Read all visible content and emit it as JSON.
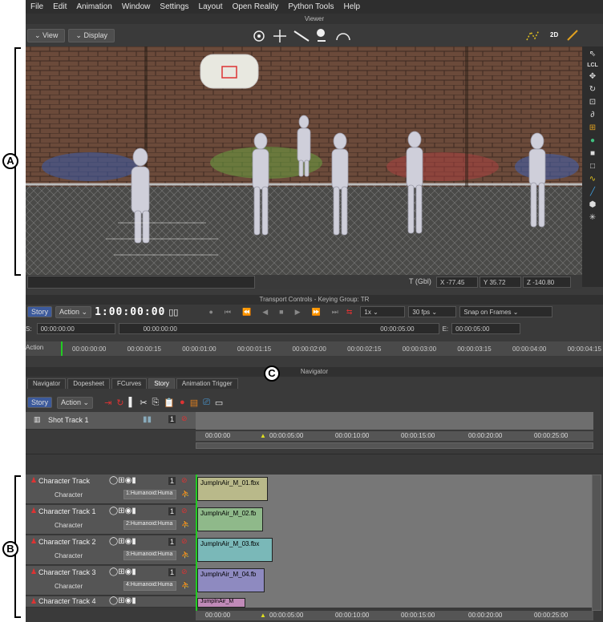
{
  "menu": [
    "File",
    "Edit",
    "Animation",
    "Window",
    "Settings",
    "Layout",
    "Open Reality",
    "Python Tools",
    "Help"
  ],
  "viewer": {
    "title": "Viewer",
    "view_btn": "View",
    "display_btn": "Display",
    "label_2d": "2D"
  },
  "viewport_side": [
    "LCL"
  ],
  "coords": {
    "label": "T (Gbl)",
    "x_label": "X",
    "x": "-77.45",
    "y_label": "Y",
    "y": "35.72",
    "z_label": "Z",
    "z": "-140.80"
  },
  "transport": {
    "title": "Transport Controls  -  Keying Group: TR",
    "story": "Story",
    "action": "Action",
    "timecode": "1:00:00:00",
    "speed": "1x",
    "fps": "30 fps",
    "snap": "Snap on Frames",
    "s_label": "S:",
    "start": "00:00:00:00",
    "start2": "00:00:00:00",
    "end": "00:00:05:00",
    "e_label": "E:",
    "end2": "00:00:05:00",
    "action_label": "Action",
    "ruler": [
      "00:00:00:00",
      "00:00:00:15",
      "00:00:01:00",
      "00:00:01:15",
      "00:00:02:00",
      "00:00:02:15",
      "00:00:03:00",
      "00:00:03:15",
      "00:00:04:00",
      "00:00:04:15"
    ]
  },
  "navigator": {
    "title": "Navigator",
    "tabs": [
      "Navigator",
      "Dopesheet",
      "FCurves",
      "Story",
      "Animation Trigger"
    ],
    "story": "Story",
    "action": "Action",
    "shot_track": "Shot Track 1",
    "ruler": [
      "00:00:00",
      "00:00:05:00",
      "00:00:10:00",
      "00:00:15:00",
      "00:00:20:00",
      "00:00:25:00"
    ],
    "tracks": [
      {
        "name": "Character Track",
        "sub": "Character",
        "sel": "1:Humanoid:Huma",
        "clip": "JumpInAir_M_01.fbx"
      },
      {
        "name": "Character Track 1",
        "sub": "Character",
        "sel": "2:Humanoid:Huma",
        "clip": "JumpInAir_M_02.fb"
      },
      {
        "name": "Character Track 2",
        "sub": "Character",
        "sel": "3:Humanoid:Huma",
        "clip": "JumpInAir_M_03.fbx"
      },
      {
        "name": "Character Track 3",
        "sub": "Character",
        "sel": "4:Humanoid:Huma",
        "clip": "JumpInAir_M_04.fb"
      },
      {
        "name": "Character Track 4",
        "sub": "",
        "sel": "",
        "clip": "JumpInAir_M"
      }
    ],
    "lock_num": "1"
  },
  "callouts": {
    "a": "A",
    "b": "B",
    "c": "C"
  },
  "colors": {
    "clip1": "#b9b98a",
    "clip2": "#8fb98a",
    "clip3": "#7ab8b8",
    "clip4": "#8e8ac0",
    "clip5": "#c08ab8"
  }
}
